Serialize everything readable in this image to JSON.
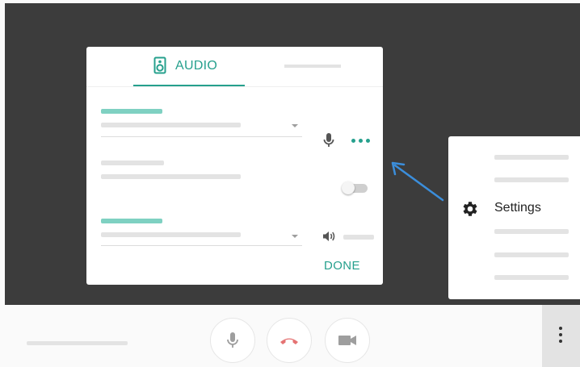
{
  "audio_dialog": {
    "active_tab_label": "AUDIO",
    "icons": {
      "tab": "speaker-icon",
      "microphone": "microphone-icon",
      "more": "more-horizontal-icon",
      "volume": "volume-icon"
    },
    "toggle_on": false,
    "done_label": "DONE"
  },
  "settings_menu": {
    "settings_label": "Settings",
    "settings_icon": "gear-icon"
  },
  "call_bar": {
    "icons": [
      "microphone-icon",
      "hang-up-icon",
      "camera-icon",
      "more-vertical-icon"
    ]
  },
  "colors": {
    "accent": "#26a08d",
    "accent_light": "#7fd1c2",
    "hangup": "#e57373",
    "arrow": "#3b8edb",
    "stage": "#3c3c3c"
  }
}
